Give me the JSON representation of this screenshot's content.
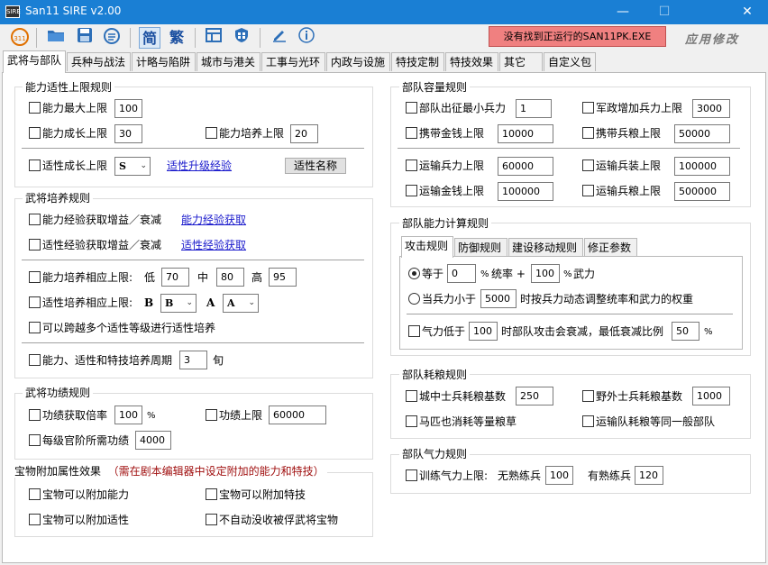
{
  "window": {
    "title": "San11 SIRE v2.00",
    "icon_text": "SIRE",
    "min_glyph": "—",
    "max_glyph": "☐",
    "close_glyph": "✕"
  },
  "toolbar": {
    "status_text": "没有找到正运行的SAN11PK.EXE",
    "brand_text": "应用修改",
    "simplified_label": "简",
    "traditional_label": "繁"
  },
  "tabs": [
    "武将与部队",
    "兵种与战法",
    "计略与陷阱",
    "城市与港关",
    "工事与光环",
    "内政与设施",
    "特技定制",
    "特技效果",
    "其它",
    "自定义包"
  ],
  "left": {
    "ability": {
      "title": "能力适性上限规则",
      "max_label": "能力最大上限",
      "max_value": "100",
      "growth_label": "能力成长上限",
      "growth_value": "30",
      "train_label": "能力培养上限",
      "train_value": "20",
      "apt_growth_label": "适性成长上限",
      "apt_growth_value": "S",
      "apt_upgrade_link": "适性升级经验",
      "apt_name_button": "适性名称"
    },
    "training": {
      "title": "武将培养规则",
      "exp_gain_label": "能力经验获取增益／衰减",
      "exp_gain_link": "能力经验获取",
      "apt_exp_label": "适性经验获取增益／衰减",
      "apt_exp_link": "适性经验获取",
      "train_resp_label": "能力培养相应上限:",
      "low_label": "低",
      "low_value": "70",
      "mid_label": "中",
      "mid_value": "80",
      "high_label": "高",
      "high_value": "95",
      "apt_resp_label": "适性培养相应上限:",
      "b_label": "B",
      "b_value": "B",
      "a_label": "A",
      "a_value": "A",
      "cross_label": "可以跨越多个适性等级进行适性培养",
      "period_label": "能力、适性和特技培养周期",
      "period_value": "3",
      "period_unit": "旬"
    },
    "merit": {
      "title": "武将功绩规则",
      "rate_label": "功绩获取倍率",
      "rate_value": "100",
      "rate_unit": "%",
      "cap_label": "功绩上限",
      "cap_value": "60000",
      "rank_label": "每级官阶所需功绩",
      "rank_value": "4000"
    },
    "treasure": {
      "title": "宝物附加属性效果",
      "hint": "（需在剧本编辑器中设定附加的能力和特技）",
      "ability_label": "宝物可以附加能力",
      "skill_label": "宝物可以附加特技",
      "apt_label": "宝物可以附加适性",
      "no_confiscate_label": "不自动没收被俘武将宝物"
    }
  },
  "right": {
    "capacity": {
      "title": "部队容量规则",
      "min_troops_label": "部队出征最小兵力",
      "min_troops_value": "1",
      "add_troops_label": "军政增加兵力上限",
      "add_troops_value": "3000",
      "gold_label": "携带金钱上限",
      "gold_value": "10000",
      "food_label": "携带兵粮上限",
      "food_value": "50000",
      "trans_troops_label": "运输兵力上限",
      "trans_troops_value": "60000",
      "trans_equip_label": "运输兵装上限",
      "trans_equip_value": "100000",
      "trans_gold_label": "运输金钱上限",
      "trans_gold_value": "100000",
      "trans_food_label": "运输兵粮上限",
      "trans_food_value": "500000"
    },
    "calc": {
      "title": "部队能力计算规则",
      "subtabs": [
        "攻击规则",
        "防御规则",
        "建设移动规则",
        "修正参数"
      ],
      "equal_label": "等于",
      "equal_value": "0",
      "pct1": "%",
      "lead_label": "统率 +",
      "lead_value": "100",
      "pct2": "%",
      "force_label": "武力",
      "when_label": "当兵力小于",
      "when_value": "5000",
      "when_suffix": "时按兵力动态调整统率和武力的权重",
      "morale_label": "气力低于",
      "morale_value": "100",
      "morale_mid": "时部队攻击会衰减，最低衰减比例",
      "morale_min_value": "50",
      "morale_unit": "%"
    },
    "food": {
      "title": "部队耗粮规则",
      "city_label": "城中士兵耗粮基数",
      "city_value": "250",
      "field_label": "野外士兵耗粮基数",
      "field_value": "1000",
      "horse_label": "马匹也消耗等量粮草",
      "transport_label": "运输队耗粮等同一般部队"
    },
    "spirit": {
      "title": "部队气力规则",
      "train_label": "训练气力上限:",
      "untrained_label": "无熟练兵",
      "untrained_value": "100",
      "trained_label": "有熟练兵",
      "trained_value": "120"
    }
  },
  "colors": {
    "titlebar": "#1a7fd4",
    "status_bg": "#f08080",
    "hint_text": "#a01010",
    "link": "#1a1acc"
  }
}
